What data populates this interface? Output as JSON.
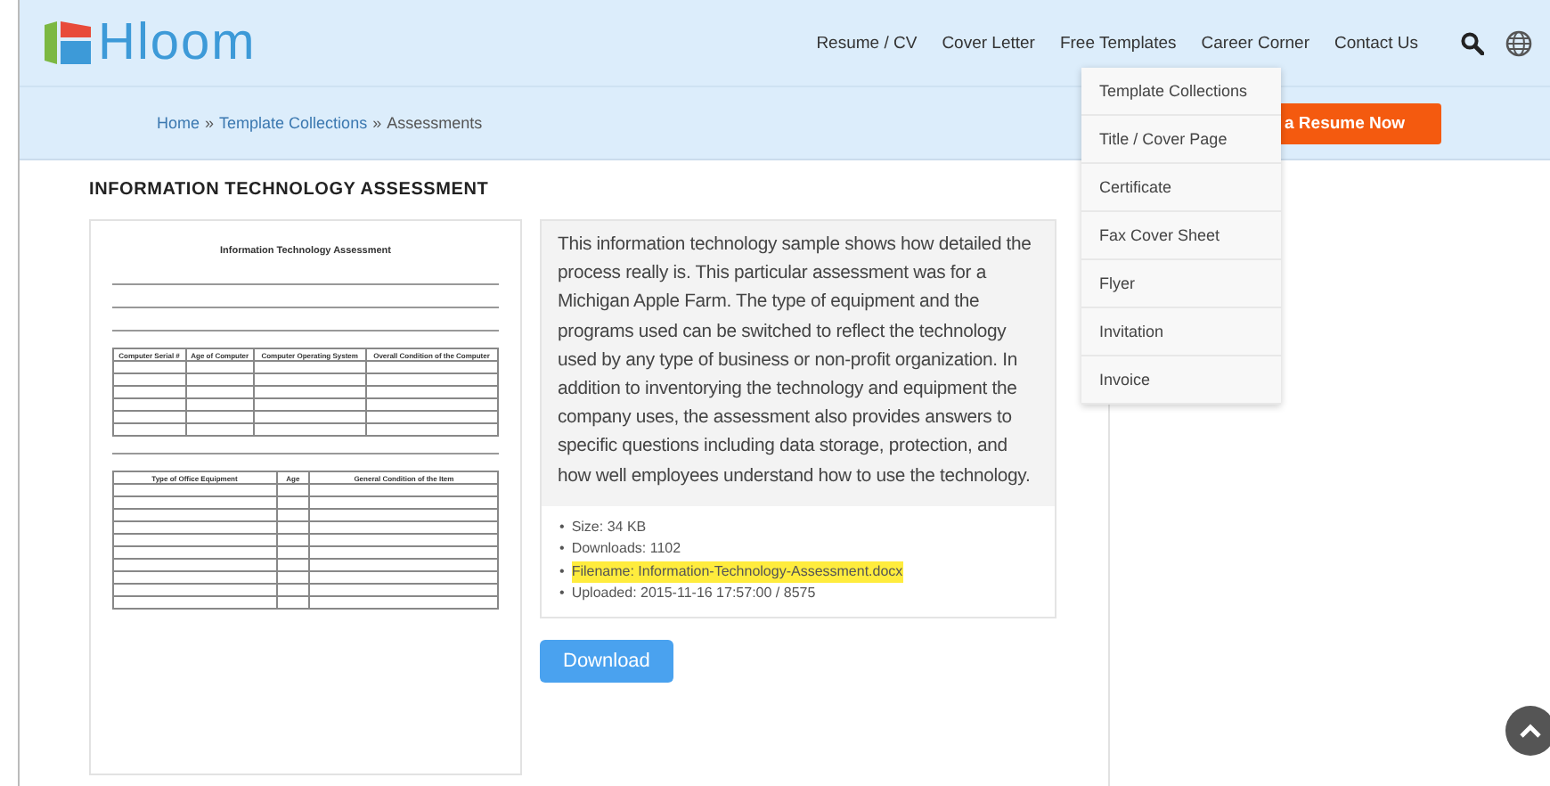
{
  "header": {
    "logo": "Hloom",
    "nav": [
      {
        "label": "Resume / CV"
      },
      {
        "label": "Cover Letter"
      },
      {
        "label": "Free Templates"
      },
      {
        "label": "Career Corner"
      },
      {
        "label": "Contact Us"
      }
    ]
  },
  "breadcrumb": [
    {
      "label": "Home",
      "link": true
    },
    {
      "label": "»",
      "link": false
    },
    {
      "label": "Template Collections",
      "link": true
    },
    {
      "label": "»",
      "link": false
    },
    {
      "label": "Assessments",
      "link": false
    }
  ],
  "cta_button": "a Resume Now",
  "dropdown": [
    {
      "label": "Template Collections"
    },
    {
      "label": "Title / Cover Page"
    },
    {
      "label": "Certificate"
    },
    {
      "label": "Fax Cover Sheet"
    },
    {
      "label": "Flyer"
    },
    {
      "label": "Invitation"
    },
    {
      "label": "Invoice"
    }
  ],
  "page_title": "INFORMATION TECHNOLOGY ASSESSMENT",
  "preview": {
    "title": "Information Technology Assessment",
    "table_1": {
      "columns": [
        "Computer Serial #",
        "Age of Computer",
        "Computer Operating System",
        "Overall Condition of the Computer"
      ]
    },
    "table_2": {
      "columns": [
        "Type of Office Equipment",
        "Age",
        "General Condition of the Item"
      ]
    }
  },
  "description": "This information technology sample shows how detailed the process really is. This particular assessment was for a Michigan Apple Farm. The type of equipment and the programs used can be switched to reflect the technology used by any type of business or non-profit organization. In addition to inventorying the technology and equipment the company uses, the assessment also provides answers to specific questions including data storage, protection, and how well employees understand how to use the technology.",
  "details": [
    {
      "bullet": "•",
      "text": "Size: 34 KB",
      "highlighted": false
    },
    {
      "bullet": "•",
      "text": "Downloads: 1102",
      "highlighted": false
    },
    {
      "bullet": "•",
      "text": "Filename: Information-Technology-Assessment.docx",
      "highlighted": true
    },
    {
      "bullet": "•",
      "text": "Uploaded: 2015-11-16 17:57:00 / 8575",
      "highlighted": false
    }
  ],
  "download_button": "Download"
}
